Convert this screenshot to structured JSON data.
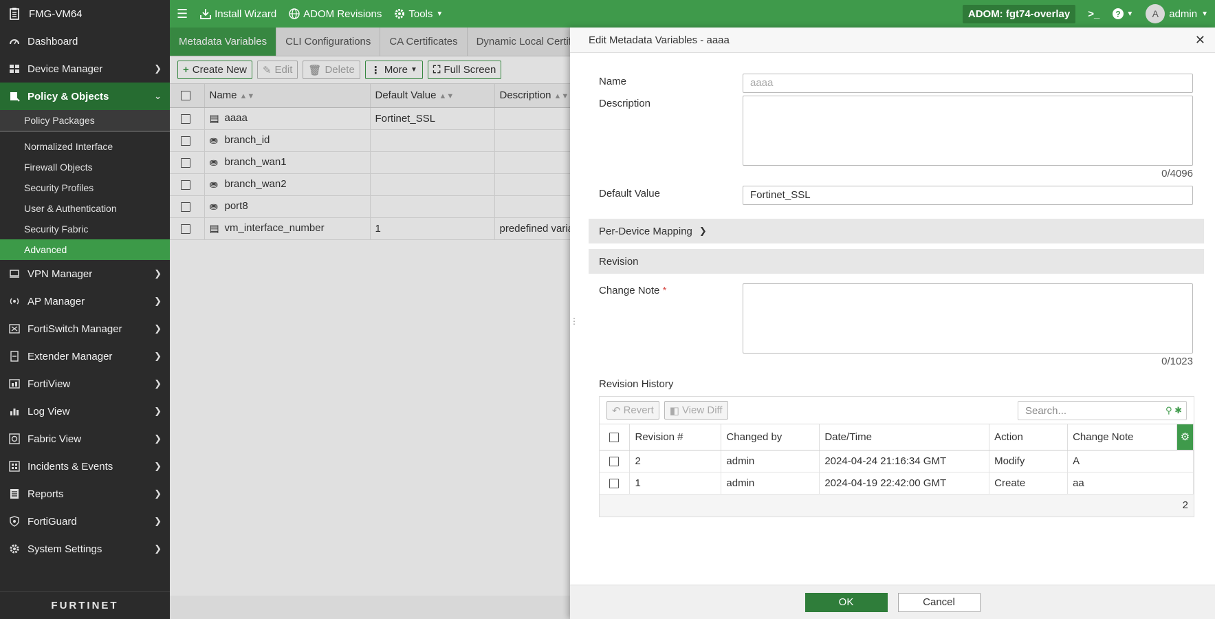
{
  "app": {
    "device_name": "FMG-VM64",
    "footer_logo": "FURTINET"
  },
  "sidebar": {
    "items": [
      {
        "label": "Dashboard",
        "icon": "dashboard-icon"
      },
      {
        "label": "Device Manager",
        "icon": "device-manager-icon"
      },
      {
        "label": "Policy & Objects",
        "icon": "policy-objects-icon"
      },
      {
        "label": "VPN Manager",
        "icon": "vpn-icon"
      },
      {
        "label": "AP Manager",
        "icon": "ap-icon"
      },
      {
        "label": "FortiSwitch Manager",
        "icon": "switch-icon"
      },
      {
        "label": "Extender Manager",
        "icon": "extender-icon"
      },
      {
        "label": "FortiView",
        "icon": "fortiview-icon"
      },
      {
        "label": "Log View",
        "icon": "log-icon"
      },
      {
        "label": "Fabric View",
        "icon": "fabric-icon"
      },
      {
        "label": "Incidents & Events",
        "icon": "incidents-icon"
      },
      {
        "label": "Reports",
        "icon": "reports-icon"
      },
      {
        "label": "FortiGuard",
        "icon": "fortiguard-icon"
      },
      {
        "label": "System Settings",
        "icon": "gear-icon"
      }
    ],
    "policy_sub": {
      "policy_packages": "Policy Packages",
      "normalized_interface": "Normalized Interface",
      "firewall_objects": "Firewall Objects",
      "security_profiles": "Security Profiles",
      "user_auth": "User & Authentication",
      "security_fabric": "Security Fabric",
      "advanced": "Advanced"
    }
  },
  "topbar": {
    "install_wizard": "Install Wizard",
    "adom_revisions": "ADOM Revisions",
    "tools": "Tools",
    "adom": "ADOM: fgt74-overlay",
    "avatar_letter": "A",
    "user": "admin"
  },
  "tabs": [
    "Metadata Variables",
    "CLI Configurations",
    "CA Certificates",
    "Dynamic Local Certific"
  ],
  "toolbar": {
    "create_new": "Create New",
    "edit": "Edit",
    "delete": "Delete",
    "more": "More",
    "full_screen": "Full Screen"
  },
  "grid": {
    "headers": {
      "name": "Name",
      "default_value": "Default Value",
      "description": "Description"
    },
    "rows": [
      {
        "name": "aaaa",
        "default_value": "Fortinet_SSL",
        "description": ""
      },
      {
        "name": "branch_id",
        "default_value": "",
        "description": ""
      },
      {
        "name": "branch_wan1",
        "default_value": "",
        "description": ""
      },
      {
        "name": "branch_wan2",
        "default_value": "",
        "description": ""
      },
      {
        "name": "port8",
        "default_value": "",
        "description": ""
      },
      {
        "name": "vm_interface_number",
        "default_value": "1",
        "description": "predefined varia"
      }
    ]
  },
  "panel": {
    "title": "Edit Metadata Variables - aaaa",
    "name_label": "Name",
    "name_value": "aaaa",
    "description_label": "Description",
    "description_counter": "0/4096",
    "default_value_label": "Default Value",
    "default_value": "Fortinet_SSL",
    "per_device_mapping": "Per-Device Mapping",
    "revision_section": "Revision",
    "change_note_label": "Change Note",
    "change_note_req": "*",
    "change_note_counter": "0/1023",
    "revision_history_label": "Revision History",
    "revert": "Revert",
    "view_diff": "View Diff",
    "search_placeholder": "Search...",
    "rh_headers": {
      "revision": "Revision #",
      "changed_by": "Changed by",
      "datetime": "Date/Time",
      "action": "Action",
      "change_note": "Change Note"
    },
    "rh_rows": [
      {
        "revision": "2",
        "changed_by": "admin",
        "datetime": "2024-04-24 21:16:34 GMT",
        "action": "Modify",
        "change_note": "A"
      },
      {
        "revision": "1",
        "changed_by": "admin",
        "datetime": "2024-04-19 22:42:00 GMT",
        "action": "Create",
        "change_note": "aa"
      }
    ],
    "rh_count": "2",
    "ok": "OK",
    "cancel": "Cancel"
  }
}
